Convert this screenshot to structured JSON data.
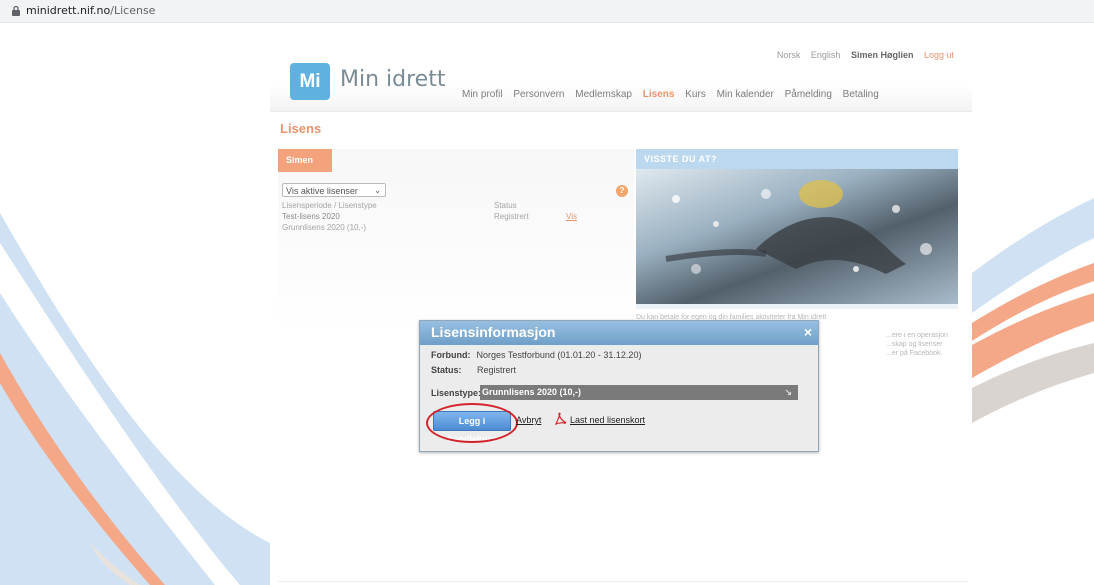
{
  "browser": {
    "url_host": "minidrett.nif.no",
    "url_path": "/License"
  },
  "header": {
    "lang_norsk": "Norsk",
    "lang_english": "English",
    "user_name": "Simen Høglien",
    "logout": "Logg ut",
    "logo_text": "Mi",
    "brand": "Min idrett"
  },
  "nav": {
    "items": [
      "Min profil",
      "Personvern",
      "Medlemskap",
      "Lisens",
      "Kurs",
      "Min kalender",
      "Påmelding",
      "Betaling"
    ],
    "active": "Lisens"
  },
  "page": {
    "title": "Lisens"
  },
  "left_panel": {
    "tab": "Simen",
    "filter_value": "Vis aktive lisenser",
    "help": "?",
    "col_period": "Lisensperiode / Lisenstype",
    "col_status": "Status",
    "rows": [
      {
        "name": "Test-lisens 2020",
        "status": "Registrert",
        "action": "Vis"
      },
      {
        "name": "Grunnlisens 2020 (10,-)",
        "status": "",
        "action": ""
      }
    ]
  },
  "info_panel": {
    "title": "VISSTE DU AT?",
    "line1": "Du kan betale for egen og din families aktiviteter fra Min idrett",
    "line2": "...ere i en operasjon",
    "line3": "...skap og lisenser",
    "line4": "...er på Facebook."
  },
  "dialog": {
    "title": "Lisensinformasjon",
    "close": "×",
    "forbund_label": "Forbund:",
    "forbund_value": "Norges Testforbund (01.01.20 - 31.12.20)",
    "status_label": "Status:",
    "status_value": "Registrert",
    "type_label": "Lisenstype:",
    "type_value": "Grunnlisens 2020 (10,-)",
    "add_to_cart": "Legg i handlekurv",
    "cancel": "Avbryt",
    "download": "Last ned lisenskort"
  },
  "colors": {
    "accent": "#e8956f",
    "tab": "#f3a27c",
    "logo": "#5fb2e0",
    "dialog_header": "#6e9fc9",
    "button": "#4d8bd3",
    "annotation": "#d2232a"
  }
}
